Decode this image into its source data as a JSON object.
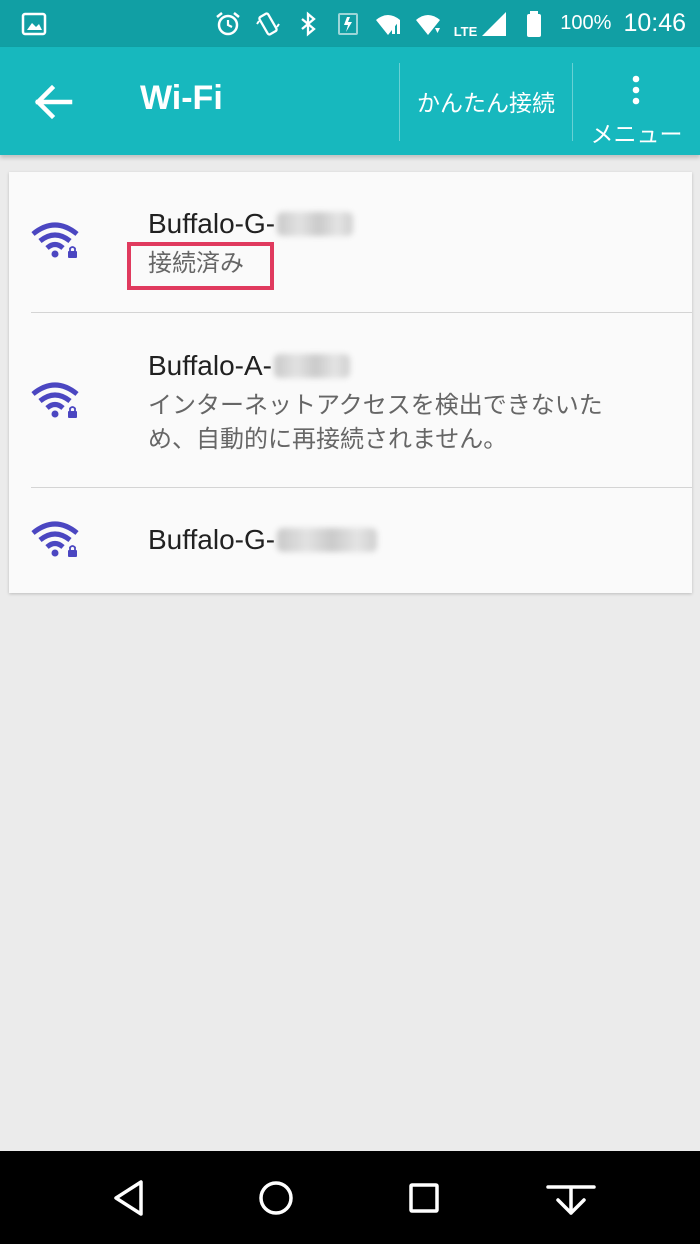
{
  "status_bar": {
    "icons": [
      "image-icon",
      "alarm-icon",
      "vibrate-icon",
      "bluetooth-icon",
      "battery-saver-icon",
      "wifi-calling-icon",
      "wifi-icon",
      "lte-signal-icon",
      "battery-icon"
    ],
    "lte": "LTE",
    "battery_percent": "100%",
    "time": "10:46"
  },
  "app_bar": {
    "title": "Wi-Fi",
    "easy_connect_label": "かんたん接続",
    "menu_label": "メニュー",
    "background_color": "#17b8be"
  },
  "networks": [
    {
      "ssid": "Buffalo-G-",
      "status": "接続済み",
      "secured": true,
      "highlighted": true
    },
    {
      "ssid": "Buffalo-A-",
      "status_line1": "インターネットアクセスを検出できないた",
      "status_line2": "め、自動的に再接続されません。",
      "secured": true
    },
    {
      "ssid": "Buffalo-G-",
      "secured": true
    }
  ],
  "colors": {
    "wifi_icon": "#4b46c1",
    "highlight_border": "#e03a5e",
    "status_bar": "#119fa4"
  },
  "nav_bar": {
    "buttons": [
      "back-icon",
      "home-icon",
      "recents-icon",
      "hide-nav-icon"
    ]
  }
}
